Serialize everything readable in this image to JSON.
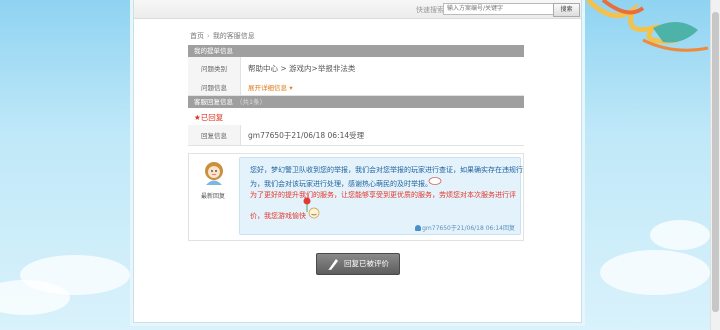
{
  "header": {
    "search_label": "快速搜索：",
    "search_placeholder": "输入方案编号/关键字",
    "search_button": "搜索"
  },
  "breadcrumb": [
    "首页",
    "我的客服信息"
  ],
  "question_section": {
    "title": "我的提单信息",
    "rows": [
      {
        "label": "问题类别",
        "value": "帮助中心 > 游戏内>举报非法类"
      },
      {
        "label": "问题信息",
        "value": "展开详细信息",
        "icon": "chevron-down-icon"
      }
    ]
  },
  "reply_section": {
    "title": "客服回复信息",
    "count": "（共1条）",
    "status": "★已回复",
    "reply_row": {
      "label": "回复信息",
      "value": "gm77650于21/06/18 06:14受理"
    },
    "avatar_label": "最新回复",
    "message_lines": [
      "您好，梦幻警卫队收到您的举报，我们会对您举报的玩家进行查证，如果确实存在违规行",
      "为，我们会对该玩家进行处理，感谢热心萌民的及时举报。",
      "为了更好的提升我们的服务，让您能够享受到更优质的服务，劳烦您对本次服务进行评",
      "价，我您游戏愉快"
    ],
    "signature": "gm77650于21/06/18 06:14回复"
  },
  "evaluate_button": "回复已被评价"
}
